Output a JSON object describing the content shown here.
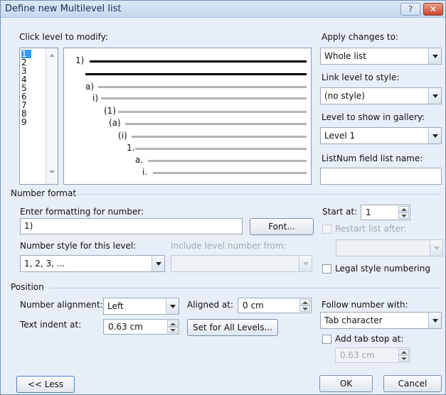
{
  "window": {
    "title": "Define new Multilevel list",
    "help_glyph": "?",
    "close_glyph": "✕"
  },
  "level_picker": {
    "label": "Click level to modify:",
    "levels": [
      "1",
      "2",
      "3",
      "4",
      "5",
      "6",
      "7",
      "8",
      "9"
    ],
    "selected": "1"
  },
  "preview": {
    "labels": [
      "1)",
      "a)",
      "i)",
      "(1)",
      "(a)",
      "(i)",
      "1.",
      "a.",
      "i."
    ]
  },
  "apply_changes": {
    "label": "Apply changes to:",
    "value": "Whole list"
  },
  "link_level": {
    "label": "Link level to style:",
    "value": "(no style)"
  },
  "gallery_level": {
    "label": "Level to show in gallery:",
    "value": "Level 1"
  },
  "listnum": {
    "label": "ListNum field list name:",
    "value": ""
  },
  "number_format": {
    "section_label": "Number format",
    "enter_label": "Enter formatting for number:",
    "format_value": "1)",
    "font_button": "Font...",
    "style_label": "Number style for this level:",
    "style_value": "1, 2, 3, ...",
    "include_label": "Include level number from:",
    "include_value": "",
    "start_label": "Start at:",
    "start_value": "1",
    "restart_label": "Restart list after:",
    "restart_value": "",
    "legal_label": "Legal style numbering"
  },
  "position": {
    "section_label": "Position",
    "alignment_label": "Number alignment:",
    "alignment_value": "Left",
    "aligned_at_label": "Aligned at:",
    "aligned_at_value": "0 cm",
    "indent_label": "Text indent at:",
    "indent_value": "0.63 cm",
    "set_all_button": "Set for All Levels...",
    "follow_label": "Follow number with:",
    "follow_value": "Tab character",
    "tab_stop_label": "Add tab stop at:",
    "tab_stop_value": "0.63 cm"
  },
  "footer": {
    "less_button": "<< Less",
    "ok_button": "OK",
    "cancel_button": "Cancel"
  }
}
